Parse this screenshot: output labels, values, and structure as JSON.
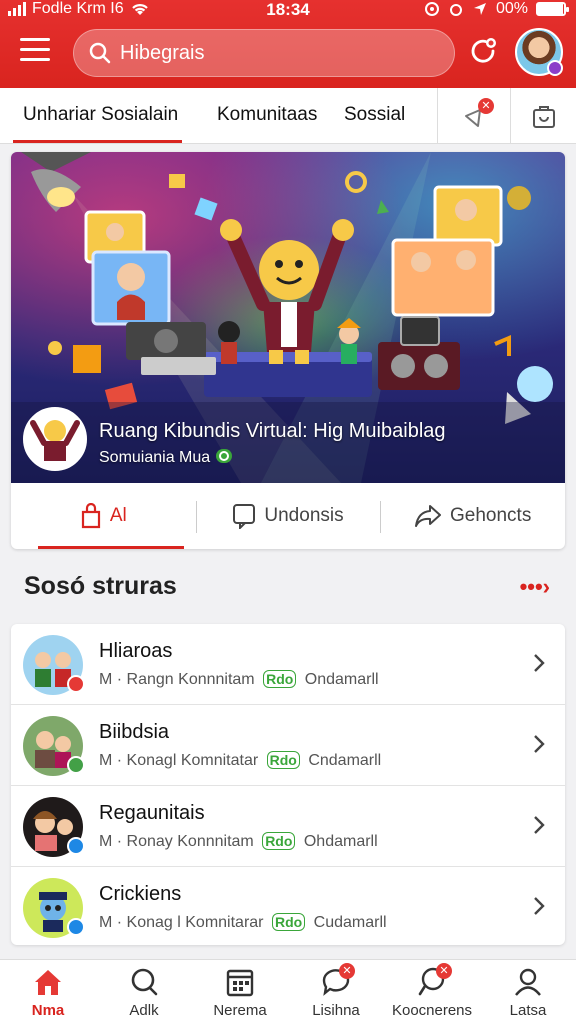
{
  "status_bar": {
    "carrier": "Fodle Krm I6",
    "time": "18:34",
    "battery": "00%",
    "battery_level": 0.95
  },
  "header": {
    "search_placeholder": "Hibegrais",
    "accent_color": "#d9241f"
  },
  "tabs": {
    "items": [
      {
        "label": "Unhariar Sosialain",
        "active": true
      },
      {
        "label": "Komunitaas",
        "active": false
      },
      {
        "label": "Sossial",
        "active": false
      }
    ],
    "icons": [
      "notification-icon",
      "bag-icon"
    ]
  },
  "featured": {
    "title": "Ruang Kibundis Virtual: Hig Muibaiblag",
    "subtitle": "Somuiania Mua",
    "actions": [
      {
        "label": "Al",
        "icon": "bag-outline-icon",
        "active": true
      },
      {
        "label": "Undonsis",
        "icon": "square-icon",
        "active": false
      },
      {
        "label": "Gehoncts",
        "icon": "share-icon",
        "active": false
      }
    ]
  },
  "section": {
    "title": "Sosó struras",
    "more": "•••›"
  },
  "communities": [
    {
      "name": "Hliaroas",
      "prefix": "M",
      "detail": "Rangn Konnnitam",
      "pill": "Rdo",
      "status": "Ondamarll",
      "avatar_bg": "#9fd3f0",
      "dot": "#e53935"
    },
    {
      "name": "Biibdsia",
      "prefix": "M",
      "detail": "Konagl Komnitatar",
      "pill": "Rdo",
      "status": "Cndamarll",
      "avatar_bg": "#7fa86a",
      "dot": "#43a047"
    },
    {
      "name": "Regaunitais",
      "prefix": "M",
      "detail": "Ronay Konnnitam",
      "pill": "Rdo",
      "status": "Ohdamarll",
      "avatar_bg": "#1f1a1a",
      "dot": "#1e88e5"
    },
    {
      "name": "Crickiens",
      "prefix": "M",
      "detail": "Konag l Komnitarar",
      "pill": "Rdo",
      "status": "Cudamarll",
      "avatar_bg": "#cde85a",
      "dot": "#1e88e5"
    }
  ],
  "bottom_nav": [
    {
      "label": "Nma",
      "icon": "home-icon",
      "active": true
    },
    {
      "label": "Adlk",
      "icon": "search-icon",
      "active": false
    },
    {
      "label": "Nerema",
      "icon": "calendar-icon",
      "active": false
    },
    {
      "label": "Lisihna",
      "icon": "chat-icon",
      "active": false
    },
    {
      "label": "Koocnerens",
      "icon": "search-chat-icon",
      "active": false
    },
    {
      "label": "Latsa",
      "icon": "profile-icon",
      "active": false
    }
  ]
}
